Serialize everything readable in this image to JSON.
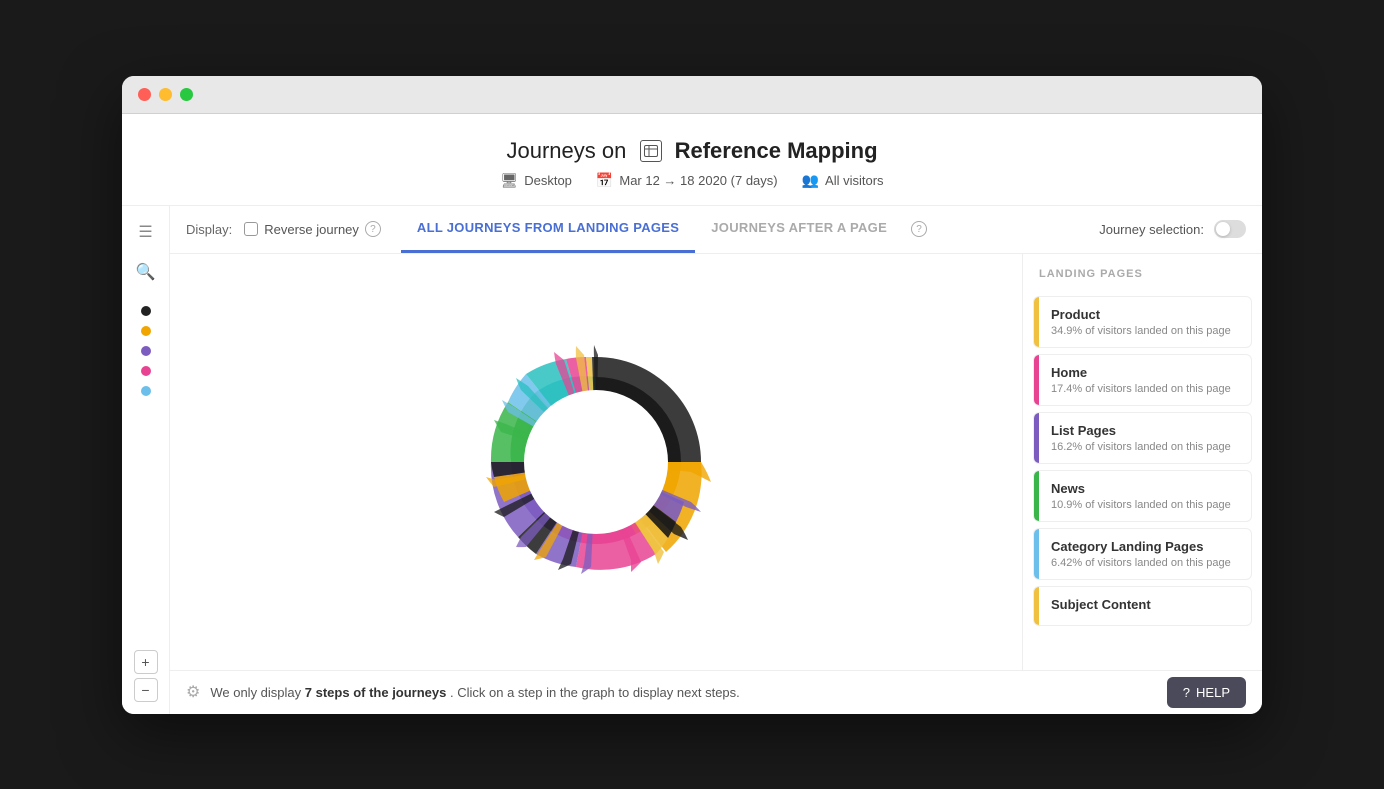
{
  "window": {
    "title": "Journeys"
  },
  "header": {
    "journeys_on": "Journeys on",
    "page_icon": "⊞",
    "page_name": "Reference Mapping",
    "device": "Desktop",
    "date_range": "Mar 12 → 18 2020 (7 days)",
    "audience": "All visitors"
  },
  "tabs_bar": {
    "display_label": "Display:",
    "reverse_journey_label": "Reverse journey",
    "tab_all_journeys": "ALL JOURNEYS FROM LANDING PAGES",
    "tab_journeys_after": "JOURNEYS AFTER A PAGE",
    "journey_selection_label": "Journey selection:"
  },
  "sidebar": {
    "dots": [
      {
        "color": "#222",
        "label": "black-dot"
      },
      {
        "color": "#f0a500",
        "label": "orange-dot"
      },
      {
        "color": "#7c5cbf",
        "label": "purple-dot"
      },
      {
        "color": "#e84393",
        "label": "pink-dot"
      },
      {
        "color": "#6bbfea",
        "label": "lightblue-dot"
      }
    ]
  },
  "right_panel": {
    "header": "LANDING PAGES",
    "items": [
      {
        "name": "Product",
        "stat": "34.9% of visitors landed on this page",
        "color": "#f0c040"
      },
      {
        "name": "Home",
        "stat": "17.4% of visitors landed on this page",
        "color": "#e84393"
      },
      {
        "name": "List Pages",
        "stat": "16.2% of visitors landed on this page",
        "color": "#7c5cbf"
      },
      {
        "name": "News",
        "stat": "10.9% of visitors landed on this page",
        "color": "#3ab54a"
      },
      {
        "name": "Category Landing Pages",
        "stat": "6.42% of visitors landed on this page",
        "color": "#6bbfea"
      },
      {
        "name": "Subject Content",
        "stat": "",
        "color": "#f0c040"
      }
    ]
  },
  "bottom_bar": {
    "prefix": "We only display",
    "highlight": "7 steps of the journeys",
    "suffix": ". Click on a step in the graph to display next steps."
  },
  "help_button": {
    "label": "HELP"
  },
  "zoom": {
    "plus": "+",
    "minus": "−"
  }
}
